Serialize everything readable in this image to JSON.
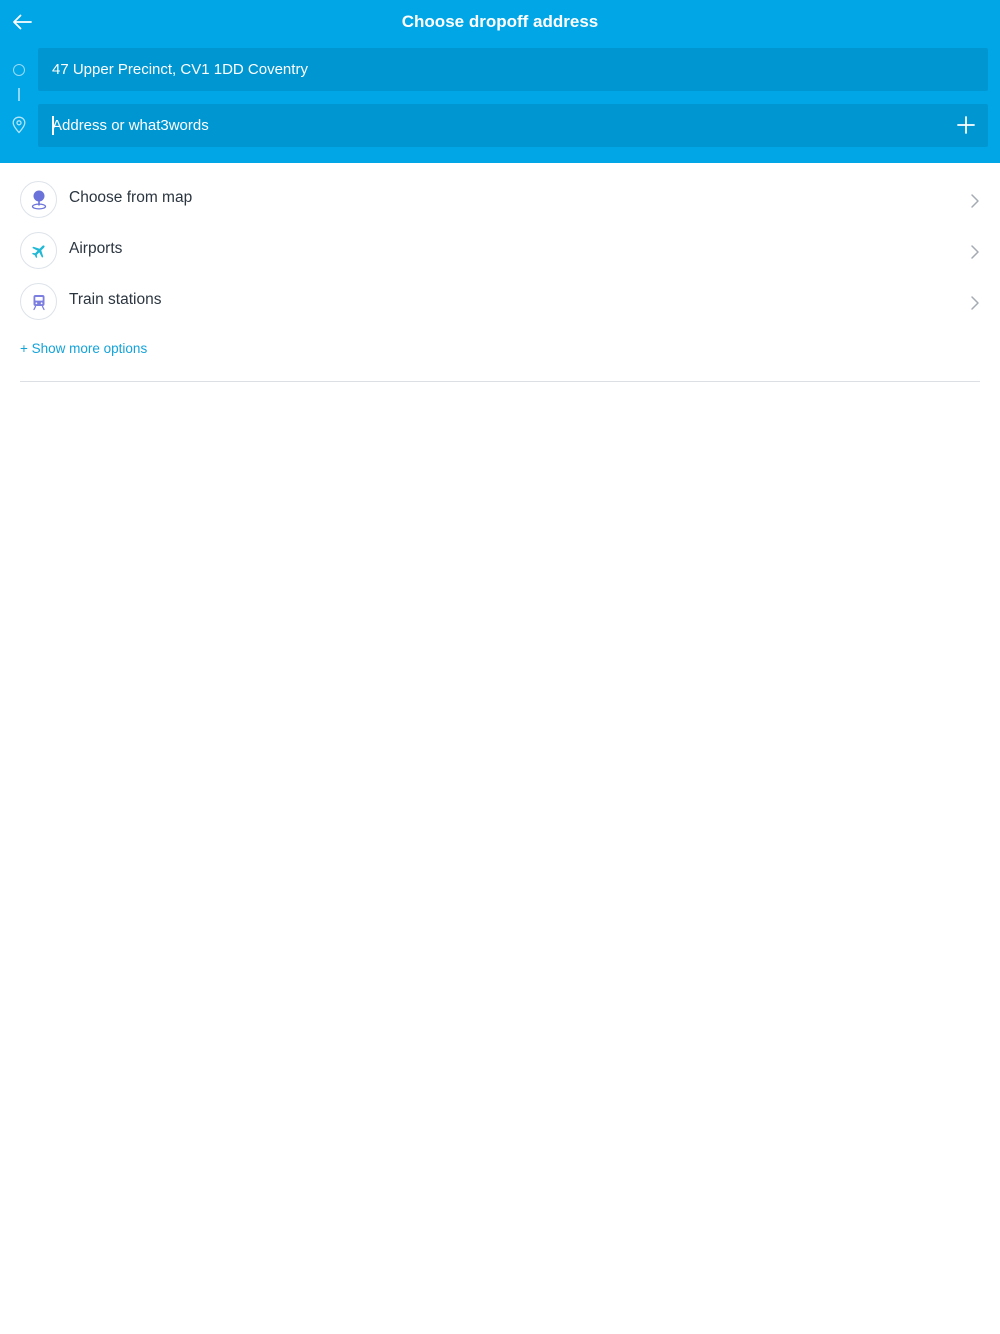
{
  "header": {
    "title": "Choose dropoff address",
    "back_icon": "arrow-left-icon",
    "background_color": "#00a6e6"
  },
  "route": {
    "origin_value": "47 Upper Precinct, CV1 1DD Coventry",
    "destination_placeholder": "Address or what3words",
    "destination_value": "",
    "add_stop_icon": "plus-icon"
  },
  "options": [
    {
      "label": "Choose from map",
      "icon": "map-pin-icon"
    },
    {
      "label": "Airports",
      "icon": "airplane-icon"
    },
    {
      "label": "Train stations",
      "icon": "train-icon"
    }
  ],
  "more_options_label": "+ Show more options",
  "accent_color": "#14a3d9"
}
